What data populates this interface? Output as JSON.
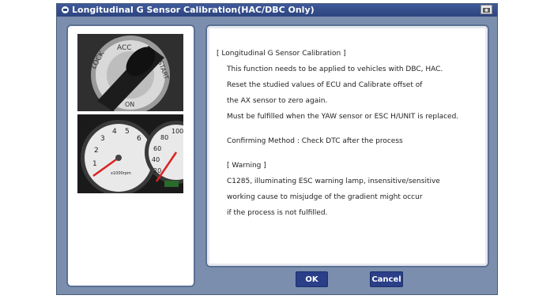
{
  "dialog": {
    "title": "Longitudinal G Sensor Calibration(HAC/DBC Only)"
  },
  "content": {
    "heading": "[ Longitudinal G Sensor Calibration ]",
    "lines": [
      "This function needs to be applied to vehicles with DBC, HAC.",
      "Reset the studied values of ECU and Calibrate offset of",
      "the AX sensor to zero again.",
      "Must be fulfilled when the YAW sensor or ESC H/UNIT is replaced."
    ],
    "confirm": "Confirming Method : Check DTC after the process",
    "warning_heading": "[ Warning ]",
    "warning_lines": [
      "C1285, illuminating ESC warning lamp, insensitive/sensitive",
      "working cause to misjudge of the gradient might occur",
      "if the process is not fulfilled."
    ]
  },
  "buttons": {
    "ok": "OK",
    "cancel": "Cancel"
  },
  "images": {
    "ignition": {
      "labels": [
        "LOCK",
        "ACC",
        "START",
        "ON"
      ]
    },
    "gauge": {
      "left_ticks": [
        "1",
        "2",
        "3",
        "4",
        "5",
        "6"
      ],
      "right_ticks": [
        "100",
        "80",
        "60",
        "40",
        "20"
      ],
      "unit": "x1000rpm"
    }
  }
}
